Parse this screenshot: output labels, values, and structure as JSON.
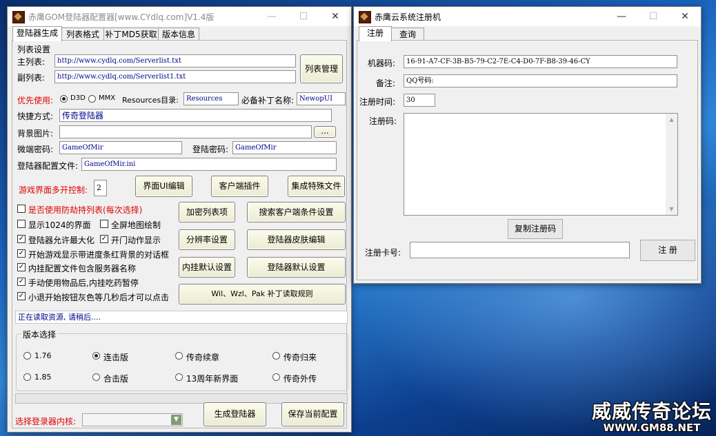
{
  "left_window": {
    "title": "赤鹰GOM登陆器配置器[www.CYdlq.com]V1.4版",
    "tabs": [
      "登陆器生成",
      "列表格式",
      "补丁MD5获取",
      "版本信息"
    ],
    "list_settings_label": "列表设置",
    "main_list_label": "主列表:",
    "main_list_value": "http://www.cydlq.com/Serverlist.txt",
    "sub_list_label": "副列表:",
    "sub_list_value": "http://www.cydlq.com/Serverlist1.txt",
    "list_manage_button": "列表管理",
    "priority_label": "优先使用:",
    "d3d_label": "D3D",
    "mmx_label": "MMX",
    "resources_label": "Resources目录:",
    "resources_value": "Resources",
    "patch_label": "必备补丁名称:",
    "patch_value": "NewopUI",
    "shortcut_label": "快捷方式:",
    "shortcut_value": "传奇登陆器",
    "bg_image_label": "背景图片:",
    "bg_image_value": "",
    "browse_button": "...",
    "micro_pwd_label": "微端密码:",
    "micro_pwd_value": "GameOfMir",
    "login_pwd_label": "登陆密码:",
    "login_pwd_value": "GameOfMir",
    "config_file_label": "登陆器配置文件:",
    "config_file_value": "GameOfMir.ini",
    "multi_open_label": "游戏界面多开控制:",
    "multi_open_value": "2",
    "ui_edit_button": "界面UI编辑",
    "client_plugin_button": "客户端插件",
    "special_file_button": "集成特殊文件",
    "options": [
      {
        "label": "是否使用防劫持列表(每次选择)",
        "checked": false,
        "red": true
      },
      {
        "label": "显示1024的界面",
        "checked": false,
        "red": false
      },
      {
        "label": "全屏地图绘制",
        "checked": false,
        "red": false
      },
      {
        "label": "登陆器允许最大化",
        "checked": true,
        "red": false
      },
      {
        "label": "开门动作显示",
        "checked": true,
        "red": false
      },
      {
        "label": "开始游戏显示带进度条红背景的对话框",
        "checked": true,
        "red": false
      },
      {
        "label": "内挂配置文件包含服务器名称",
        "checked": true,
        "red": false
      },
      {
        "label": "手动使用物品后,内挂吃药暂停",
        "checked": true,
        "red": false
      },
      {
        "label": "小退开始按钮灰色等几秒后才可以点击",
        "checked": true,
        "red": false
      }
    ],
    "encrypt_list_button": "加密列表项",
    "search_client_button": "搜索客户端条件设置",
    "resolution_button": "分辨率设置",
    "skin_edit_button": "登陆器皮肤编辑",
    "plugin_default_button": "内挂默认设置",
    "launcher_default_button": "登陆器默认设置",
    "patch_rule_button": "Wil、Wzl、Pak 补丁读取规则",
    "status_text": "正在读取资源, 请稍后....",
    "version_group_label": "版本选择",
    "versions": [
      {
        "label": "1.76",
        "selected": false
      },
      {
        "label": "连击版",
        "selected": true
      },
      {
        "label": "传奇续章",
        "selected": false
      },
      {
        "label": "传奇归来",
        "selected": false
      },
      {
        "label": "1.85",
        "selected": false
      },
      {
        "label": "合击版",
        "selected": false
      },
      {
        "label": "13周年新界面",
        "selected": false
      },
      {
        "label": "传奇外传",
        "selected": false
      }
    ],
    "kernel_label": "选择登录器内核:",
    "generate_button": "生成登陆器",
    "save_button": "保存当前配置"
  },
  "right_window": {
    "title": "赤鹰云系统注册机",
    "tabs": [
      "注册",
      "查询"
    ],
    "machine_code_label": "机器码:",
    "machine_code_value": "16-91-A7-CF-3B-B5-79-C2-7E-C4-D0-7F-B8-39-46-CY",
    "remark_label": "备注:",
    "remark_value": "QQ号码:",
    "reg_time_label": "注册时间:",
    "reg_time_value": "30",
    "reg_code_label": "注册码:",
    "reg_code_value": "",
    "copy_button": "复制注册码",
    "card_label": "注册卡号:",
    "card_value": "",
    "register_button": "注 册"
  },
  "window_controls": {
    "minimize": "—",
    "maximize": "☐",
    "close": "✕"
  },
  "watermark": {
    "line1": "威威传奇论坛",
    "line2": "WWW.GM88.NET"
  }
}
